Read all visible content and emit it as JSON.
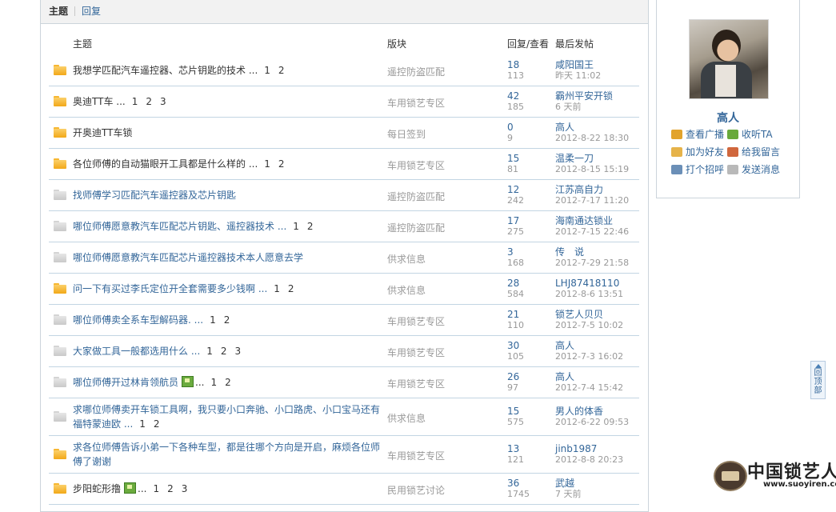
{
  "tabs": {
    "active": "主题",
    "other": "回复"
  },
  "headers": {
    "subject": "主题",
    "forum": "版块",
    "replies_views": "回复/查看",
    "last_post": "最后发帖"
  },
  "threads": [
    {
      "icon": "folder-hot",
      "title": "我想学匹配汽车遥控器、芯片钥匙的技术 ...",
      "pages": [
        "1",
        "2"
      ],
      "forum": "遥控防盗匹配",
      "replies": "18",
      "views": "113",
      "author": "咸阳国王",
      "time": "昨天 11:02"
    },
    {
      "icon": "folder-hot",
      "title": "奥迪TT车 ...",
      "pages": [
        "1",
        "2",
        "3"
      ],
      "forum": "车用锁艺专区",
      "replies": "42",
      "views": "185",
      "author": "霸州平安开锁",
      "time": "6 天前"
    },
    {
      "icon": "folder-hot",
      "title": "开奥迪TT车锁",
      "pages": [],
      "forum": "每日签到",
      "replies": "0",
      "views": "9",
      "author": "高人",
      "time": "2012-8-22 18:30"
    },
    {
      "icon": "folder-hot",
      "title": "各位师傅的自动猫眼开工具都是什么样的 ...",
      "pages": [
        "1",
        "2"
      ],
      "forum": "车用锁艺专区",
      "replies": "15",
      "views": "81",
      "author": "温柔一刀",
      "time": "2012-8-15 15:19"
    },
    {
      "icon": "folder-cold",
      "title": "找师傅学习匹配汽车遥控器及芯片钥匙",
      "pages": [],
      "forum": "遥控防盗匹配",
      "replies": "12",
      "views": "242",
      "author": "江苏高自力",
      "time": "2012-7-17 11:20",
      "blue": true
    },
    {
      "icon": "folder-cold",
      "title": "哪位师傅愿意教汽车匹配芯片钥匙、遥控器技术 ...",
      "pages": [
        "1",
        "2"
      ],
      "forum": "遥控防盗匹配",
      "replies": "17",
      "views": "275",
      "author": "海南通达锁业",
      "time": "2012-7-15 22:46",
      "blue": true
    },
    {
      "icon": "folder-cold",
      "title": "哪位师傅愿意教汽车匹配芯片遥控器技术本人愿意去学",
      "pages": [],
      "forum": "供求信息",
      "replies": "3",
      "views": "168",
      "author": "传　说",
      "time": "2012-7-29 21:58",
      "blue": true
    },
    {
      "icon": "folder-hot",
      "title": "问一下有买过李氏定位开全套需要多少钱啊 ...",
      "pages": [
        "1",
        "2"
      ],
      "forum": "供求信息",
      "replies": "28",
      "views": "584",
      "author": "LHJ87418110",
      "time": "2012-8-6 13:51",
      "blue": true
    },
    {
      "icon": "folder-cold",
      "title": "哪位师傅卖全系车型解码器. ...",
      "pages": [
        "1",
        "2"
      ],
      "forum": "车用锁艺专区",
      "replies": "21",
      "views": "110",
      "author": "锁艺人贝贝",
      "time": "2012-7-5 10:02",
      "blue": true
    },
    {
      "icon": "folder-cold",
      "title": "大家做工具一般都选用什么 ...",
      "pages": [
        "1",
        "2",
        "3"
      ],
      "forum": "车用锁艺专区",
      "replies": "30",
      "views": "105",
      "author": "高人",
      "time": "2012-7-3 16:02",
      "blue": true
    },
    {
      "icon": "folder-cold",
      "title": "哪位师傅开过林肯领航员",
      "attach": true,
      "suffix": "...",
      "pages": [
        "1",
        "2"
      ],
      "forum": "车用锁艺专区",
      "replies": "26",
      "views": "97",
      "author": "高人",
      "time": "2012-7-4 15:42",
      "blue": true
    },
    {
      "icon": "folder-cold",
      "title": "求哪位师傅卖开车锁工具啊，我只要小口奔驰、小口路虎、小口宝马还有福特蒙迪欧 ...",
      "pages": [
        "1",
        "2"
      ],
      "forum": "供求信息",
      "replies": "15",
      "views": "575",
      "author": "男人的体香",
      "time": "2012-6-22 09:53",
      "blue": true
    },
    {
      "icon": "folder-hot",
      "title": "求各位师傅告诉小弟一下各种车型，都是往哪个方向是开启，麻烦各位师傅了谢谢",
      "pages": [],
      "forum": "车用锁艺专区",
      "replies": "13",
      "views": "121",
      "author": "jinb1987",
      "time": "2012-8-8 20:23",
      "blue": true
    },
    {
      "icon": "folder-hot",
      "title": "步阳蛇形撸",
      "attach": true,
      "suffix": "...",
      "pages": [
        "1",
        "2",
        "3"
      ],
      "forum": "民用锁艺讨论",
      "replies": "36",
      "views": "1745",
      "author": "武越",
      "time": "7 天前"
    }
  ],
  "profile": {
    "name": "高人",
    "links": [
      {
        "label": "查看广播",
        "icon": "broadcast-icon",
        "color": "#e2a32b"
      },
      {
        "label": "收听TA",
        "icon": "follow-icon",
        "color": "#69a93b"
      },
      {
        "label": "加为好友",
        "icon": "add-friend-icon",
        "color": "#e6b34a"
      },
      {
        "label": "给我留言",
        "icon": "message-pencil-icon",
        "color": "#d0673d"
      },
      {
        "label": "打个招呼",
        "icon": "greet-icon",
        "color": "#6b8fb7"
      },
      {
        "label": "发送消息",
        "icon": "envelope-icon",
        "color": "#b9b9b9"
      }
    ]
  },
  "back_to_top": {
    "label": "回顶部"
  },
  "watermark": {
    "brand": "中国锁艺人",
    "url": "www.suoyiren.com"
  }
}
